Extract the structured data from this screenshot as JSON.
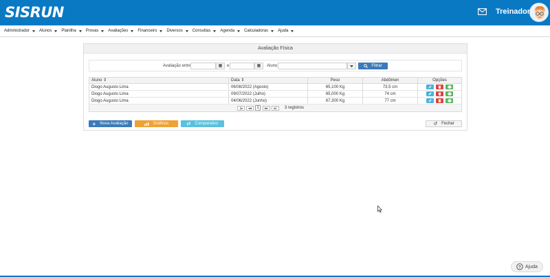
{
  "app": {
    "logo": "SISRUN",
    "user_name": "Treinador"
  },
  "menu": {
    "items": [
      "Administrador",
      "Alunos",
      "Planilha",
      "Provas",
      "Avaliações",
      "Financeiro",
      "Diversos",
      "Consultas",
      "Agenda",
      "Calculadoras",
      "Ajuda"
    ]
  },
  "panel": {
    "title": "Avaliação Física"
  },
  "filter": {
    "label_between": "Avaliação entre",
    "label_and": "e",
    "label_student": "Aluno",
    "date_from": "",
    "date_to": "",
    "student": "",
    "button": "Filtrar"
  },
  "table": {
    "columns": [
      "Aluno",
      "Data",
      "Peso",
      "Abdômen",
      "Opções"
    ],
    "rows": [
      {
        "aluno": "Diogo Augusto Lima",
        "data": "06/08/2022 (Agosto)",
        "peso": "65,100 Kg",
        "abdomen": "73.5 cm"
      },
      {
        "aluno": "Diogo Augusto Lima",
        "data": "09/07/2022 (Julho)",
        "peso": "65,000 Kg",
        "abdomen": "74 cm"
      },
      {
        "aluno": "Diogo Augusto Lima",
        "data": "04/06/2022 (Junho)",
        "peso": "67,300 Kg",
        "abdomen": "77 cm"
      }
    ],
    "pager": {
      "page": "1",
      "count": "3 registros"
    }
  },
  "actions": {
    "new": "Nova Avaliação",
    "charts": "Gráficos",
    "compare": "Comparativo",
    "close": "Fechar"
  },
  "help": {
    "label": "Ajuda"
  },
  "colors": {
    "brand": "#0a79c4",
    "primary_button": "#3c7ab9",
    "charts_button": "#eea236",
    "compare_button": "#5bc0de",
    "delete": "#d9443f",
    "print": "#57b35b",
    "edit": "#4ab2dd"
  }
}
